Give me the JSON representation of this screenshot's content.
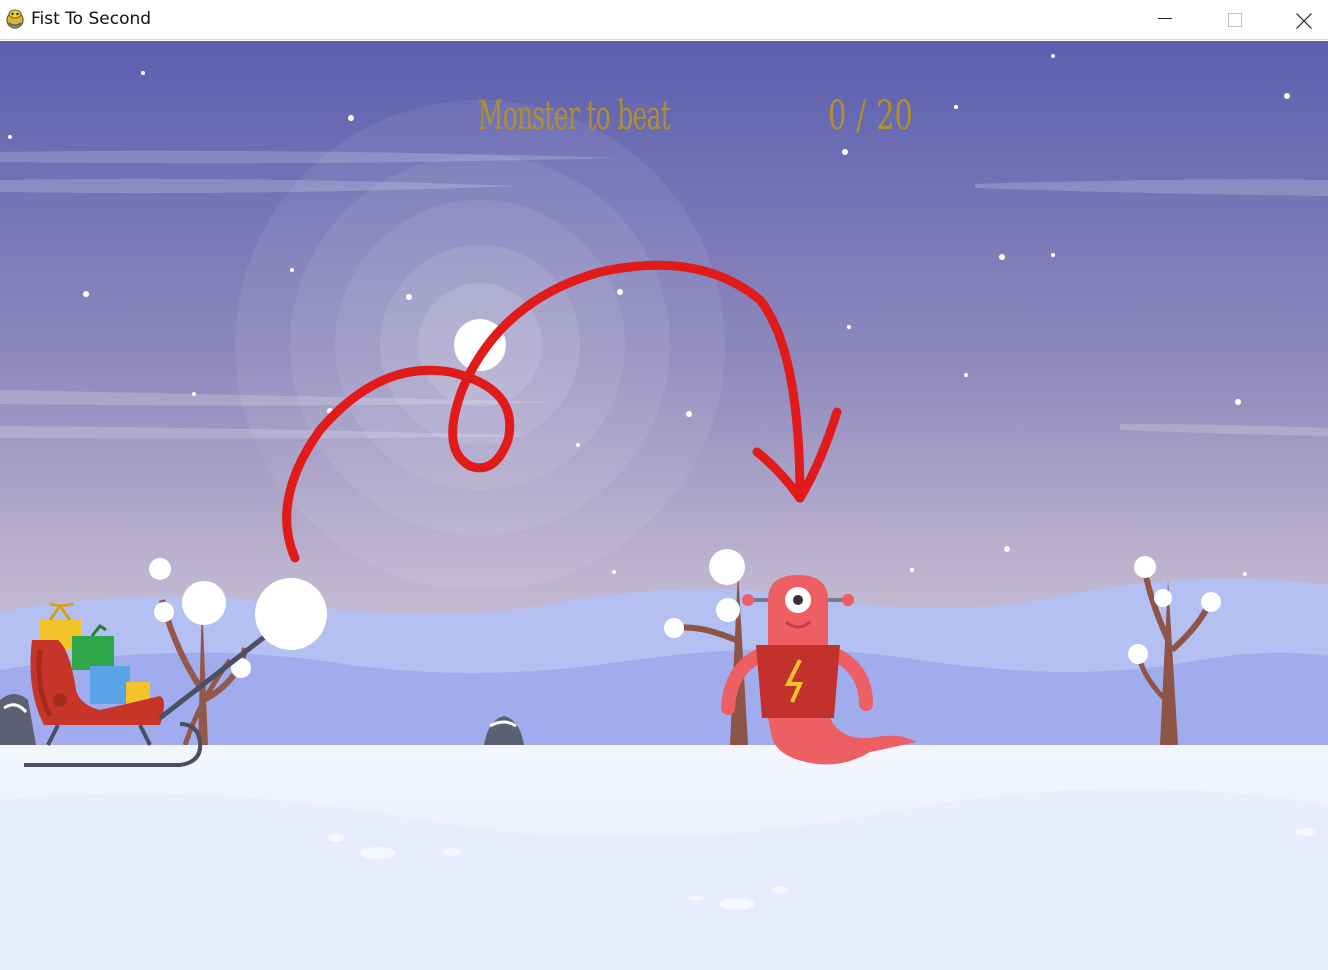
{
  "window": {
    "title": "Fist To Second",
    "app_icon": "pygame-snake-icon",
    "controls": {
      "minimize_icon": "minimize-icon",
      "maximize_icon": "maximize-icon",
      "close_icon": "close-icon"
    }
  },
  "hud": {
    "label": "Monster to beat",
    "current": "0",
    "separator": "/",
    "total": "20"
  },
  "scene": {
    "season": "winter night",
    "player": "santa-sleigh-with-slingshot",
    "projectile": "snowball",
    "enemy": "one-eyed-red-monster",
    "annotation": "red-hand-drawn-arrow"
  },
  "colors": {
    "sky_top": "#5b5fb0",
    "sky_bottom": "#cbc3d6",
    "hud_text": "#b0902a",
    "annotation_red": "#e11a1a",
    "hills": "#a6b3ee",
    "snow": "#eef2fb",
    "monster": "#ee5f63"
  }
}
